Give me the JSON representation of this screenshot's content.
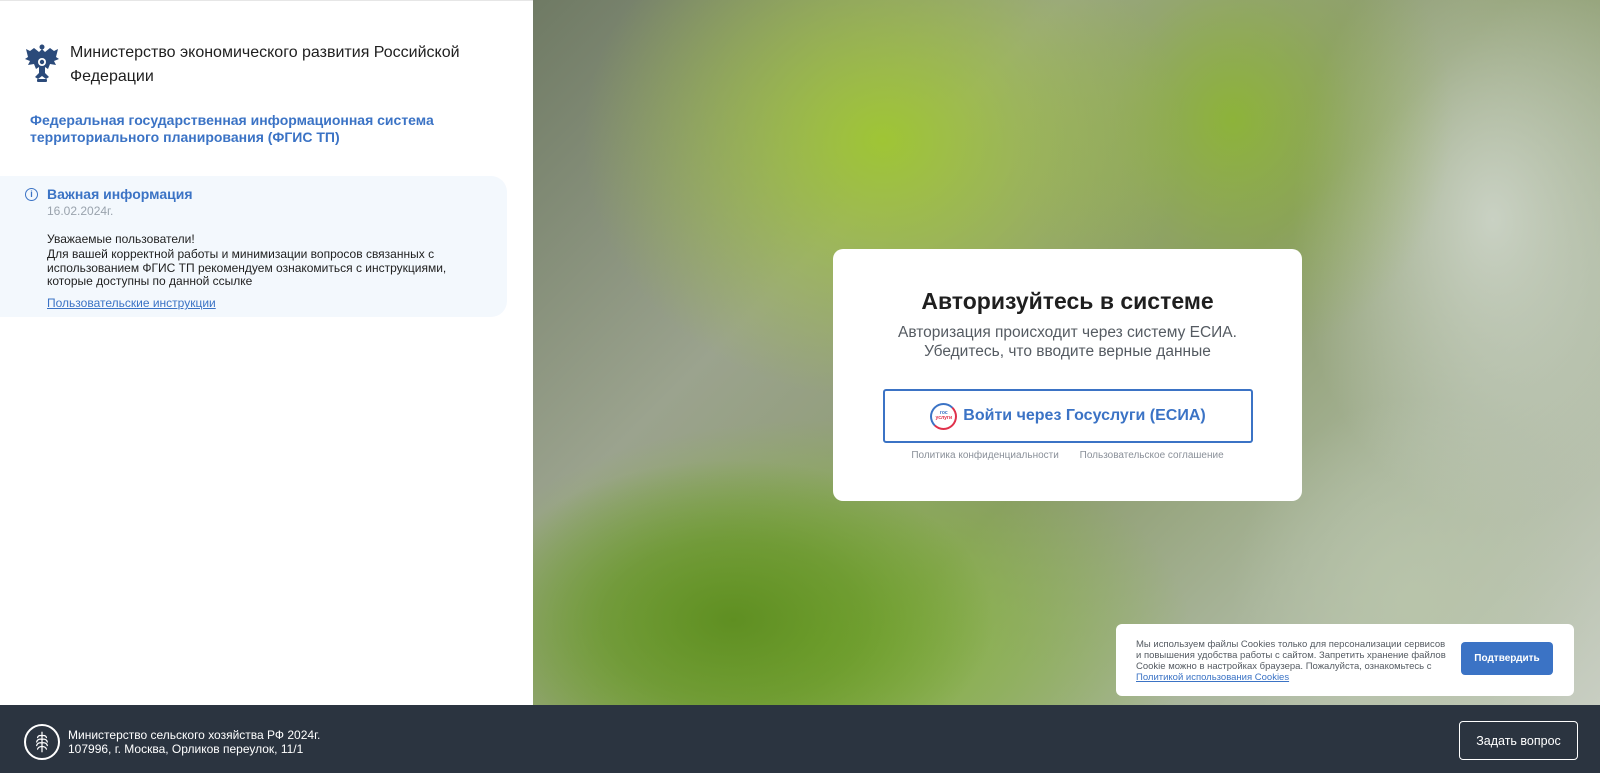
{
  "header": {
    "ministry_name": "Министерство экономического развития Российской Федерации",
    "system_title": "Федеральная государственная информационная система территориального планирования (ФГИС ТП)",
    "emblem_icon": "double-headed-eagle-emblem-icon"
  },
  "info": {
    "icon": "info-icon",
    "title": "Важная информация",
    "date": "16.02.2024г.",
    "greeting": "Уважаемые пользователи!",
    "text": "Для вашей корректной работы и минимизации вопросов связанных с использованием ФГИС ТП рекомендуем ознакомиться с инструкциями, которые доступны по данной ссылке",
    "link": "Пользовательские инструкции"
  },
  "auth": {
    "title": "Авторизуйтесь в системе",
    "subtitle_line1": "Авторизация происходит через систему ЕСИА.",
    "subtitle_line2": "Убедитесь, что вводите верные данные",
    "button_label": "Войти через Госуслуги (ЕСИА)",
    "logo_text_top": "гос",
    "logo_text_bottom": "услуги",
    "privacy_link": "Политика конфиденциальности",
    "agreement_link": "Пользовательское соглашение"
  },
  "cookie": {
    "text": "Мы используем файлы Cookies только для персонализации сервисов и повышения удобства работы с сайтом. Запретить хранение файлов Cookie можно в настройках браузера. Пожалуйста, ознакомьтесь с ",
    "link": "Политикой использования Cookies",
    "button": "Подтвердить"
  },
  "footer": {
    "logo_icon": "wheat-emblem-icon",
    "line1": "Министерство сельского хозяйства РФ 2024г.",
    "line2": "107996, г. Москва, Орликов переулок, 11/1",
    "ask_button": "Задать вопрос"
  },
  "colors": {
    "accent": "#3b73c5",
    "footer_bg": "#2b3440",
    "info_bg": "#f3f8fd"
  }
}
